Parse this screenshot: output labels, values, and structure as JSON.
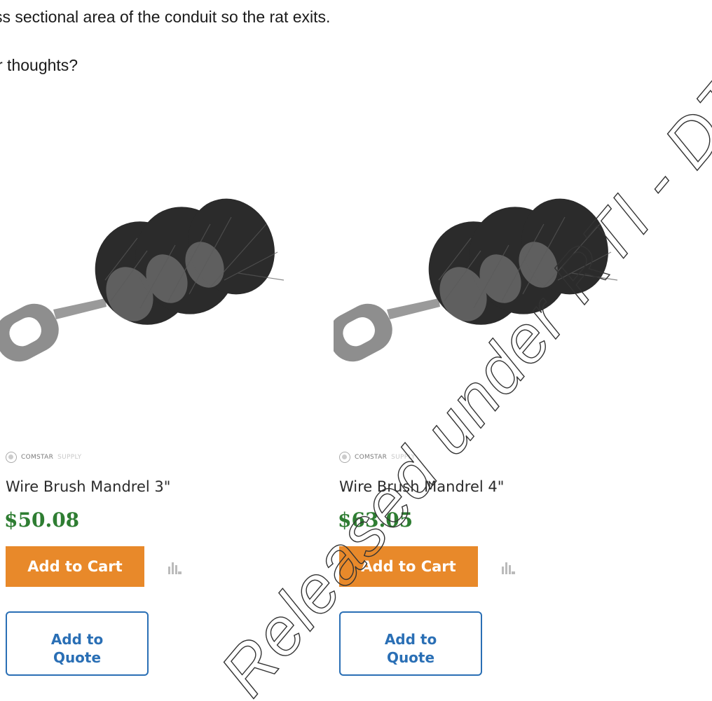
{
  "document": {
    "line1": "ss sectional area of the conduit so the rat exits.",
    "line2": "r thoughts?"
  },
  "products": [
    {
      "brand_primary": "COMSTAR",
      "brand_secondary": "SUPPLY",
      "name": "Wire Brush Mandrel 3\"",
      "price": "$50.08",
      "cart_label": "Add to Cart",
      "quote_label": "Add to\nQuote",
      "icons": {
        "compare": "compare-icon",
        "brand": "brand-logo-icon"
      }
    },
    {
      "brand_primary": "COMSTAR",
      "brand_secondary": "SUPPLY",
      "name": "Wire Brush Mandrel 4\"",
      "price": "$63.05",
      "cart_label": "Add to Cart",
      "quote_label": "Add to\nQuote",
      "icons": {
        "compare": "compare-icon",
        "brand": "brand-logo-icon"
      }
    }
  ],
  "watermark": {
    "text": "Released under RTI - DTMR"
  },
  "colors": {
    "price": "#2e7d32",
    "cart_button": "#e8892a",
    "quote_border": "#2a6fb5",
    "brush_bristles": "#2b2b2b",
    "brush_handle": "#8f8f8f"
  }
}
